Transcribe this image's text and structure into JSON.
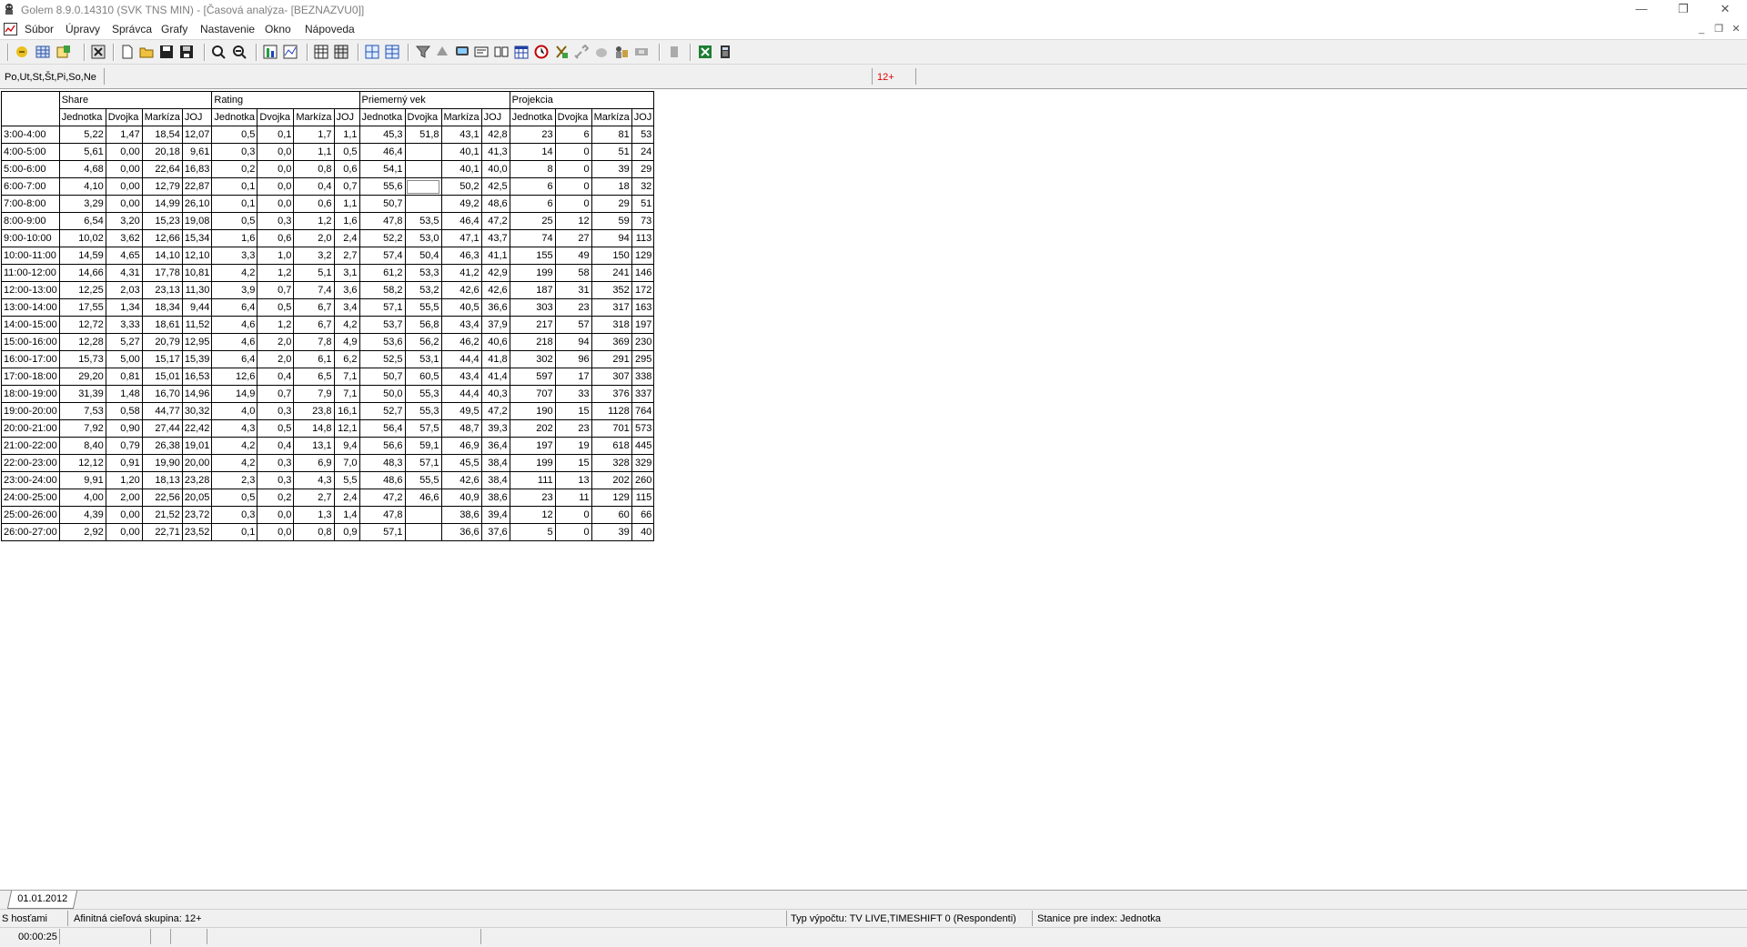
{
  "window": {
    "title": "Golem 8.9.0.14310 (SVK TNS MIN) - [Časová analýza- [BEZNAZVU0]]",
    "controls": {
      "minimize": "—",
      "restore": "❐",
      "close": "✕"
    }
  },
  "menu": [
    "Súbor",
    "Úpravy",
    "Správca",
    "Grafy",
    "Nastavenie",
    "Okno",
    "Nápoveda"
  ],
  "filter": {
    "days": "Po,Ut,St,Št,Pi,So,Ne",
    "target": "12+"
  },
  "table": {
    "groups": [
      "Share",
      "Rating",
      "Priemerný vek",
      "Projekcia"
    ],
    "columns": [
      "Jednotka",
      "Dvojka",
      "Markíza",
      "JOJ"
    ],
    "rows": [
      {
        "label": "3:00-4:00",
        "v": [
          "5,22",
          "1,47",
          "18,54",
          "12,07",
          "0,5",
          "0,1",
          "1,7",
          "1,1",
          "45,3",
          "51,8",
          "43,1",
          "42,8",
          "23",
          "6",
          "81",
          "53"
        ]
      },
      {
        "label": "4:00-5:00",
        "v": [
          "5,61",
          "0,00",
          "20,18",
          "9,61",
          "0,3",
          "0,0",
          "1,1",
          "0,5",
          "46,4",
          "",
          "40,1",
          "41,3",
          "14",
          "0",
          "51",
          "24"
        ]
      },
      {
        "label": "5:00-6:00",
        "v": [
          "4,68",
          "0,00",
          "22,64",
          "16,83",
          "0,2",
          "0,0",
          "0,8",
          "0,6",
          "54,1",
          "",
          "40,1",
          "40,0",
          "8",
          "0",
          "39",
          "29"
        ]
      },
      {
        "label": "6:00-7:00",
        "v": [
          "4,10",
          "0,00",
          "12,79",
          "22,87",
          "0,1",
          "0,0",
          "0,4",
          "0,7",
          "55,6",
          "",
          "50,2",
          "42,5",
          "6",
          "0",
          "18",
          "32"
        ]
      },
      {
        "label": "7:00-8:00",
        "v": [
          "3,29",
          "0,00",
          "14,99",
          "26,10",
          "0,1",
          "0,0",
          "0,6",
          "1,1",
          "50,7",
          "",
          "49,2",
          "48,6",
          "6",
          "0",
          "29",
          "51"
        ]
      },
      {
        "label": "8:00-9:00",
        "v": [
          "6,54",
          "3,20",
          "15,23",
          "19,08",
          "0,5",
          "0,3",
          "1,2",
          "1,6",
          "47,8",
          "53,5",
          "46,4",
          "47,2",
          "25",
          "12",
          "59",
          "73"
        ]
      },
      {
        "label": "9:00-10:00",
        "v": [
          "10,02",
          "3,62",
          "12,66",
          "15,34",
          "1,6",
          "0,6",
          "2,0",
          "2,4",
          "52,2",
          "53,0",
          "47,1",
          "43,7",
          "74",
          "27",
          "94",
          "113"
        ]
      },
      {
        "label": "10:00-11:00",
        "v": [
          "14,59",
          "4,65",
          "14,10",
          "12,10",
          "3,3",
          "1,0",
          "3,2",
          "2,7",
          "57,4",
          "50,4",
          "46,3",
          "41,1",
          "155",
          "49",
          "150",
          "129"
        ]
      },
      {
        "label": "11:00-12:00",
        "v": [
          "14,66",
          "4,31",
          "17,78",
          "10,81",
          "4,2",
          "1,2",
          "5,1",
          "3,1",
          "61,2",
          "53,3",
          "41,2",
          "42,9",
          "199",
          "58",
          "241",
          "146"
        ]
      },
      {
        "label": "12:00-13:00",
        "v": [
          "12,25",
          "2,03",
          "23,13",
          "11,30",
          "3,9",
          "0,7",
          "7,4",
          "3,6",
          "58,2",
          "53,2",
          "42,6",
          "42,6",
          "187",
          "31",
          "352",
          "172"
        ]
      },
      {
        "label": "13:00-14:00",
        "v": [
          "17,55",
          "1,34",
          "18,34",
          "9,44",
          "6,4",
          "0,5",
          "6,7",
          "3,4",
          "57,1",
          "55,5",
          "40,5",
          "36,6",
          "303",
          "23",
          "317",
          "163"
        ]
      },
      {
        "label": "14:00-15:00",
        "v": [
          "12,72",
          "3,33",
          "18,61",
          "11,52",
          "4,6",
          "1,2",
          "6,7",
          "4,2",
          "53,7",
          "56,8",
          "43,4",
          "37,9",
          "217",
          "57",
          "318",
          "197"
        ]
      },
      {
        "label": "15:00-16:00",
        "v": [
          "12,28",
          "5,27",
          "20,79",
          "12,95",
          "4,6",
          "2,0",
          "7,8",
          "4,9",
          "53,6",
          "56,2",
          "46,2",
          "40,6",
          "218",
          "94",
          "369",
          "230"
        ]
      },
      {
        "label": "16:00-17:00",
        "v": [
          "15,73",
          "5,00",
          "15,17",
          "15,39",
          "6,4",
          "2,0",
          "6,1",
          "6,2",
          "52,5",
          "53,1",
          "44,4",
          "41,8",
          "302",
          "96",
          "291",
          "295"
        ]
      },
      {
        "label": "17:00-18:00",
        "v": [
          "29,20",
          "0,81",
          "15,01",
          "16,53",
          "12,6",
          "0,4",
          "6,5",
          "7,1",
          "50,7",
          "60,5",
          "43,4",
          "41,4",
          "597",
          "17",
          "307",
          "338"
        ]
      },
      {
        "label": "18:00-19:00",
        "v": [
          "31,39",
          "1,48",
          "16,70",
          "14,96",
          "14,9",
          "0,7",
          "7,9",
          "7,1",
          "50,0",
          "55,3",
          "44,4",
          "40,3",
          "707",
          "33",
          "376",
          "337"
        ]
      },
      {
        "label": "19:00-20:00",
        "v": [
          "7,53",
          "0,58",
          "44,77",
          "30,32",
          "4,0",
          "0,3",
          "23,8",
          "16,1",
          "52,7",
          "55,3",
          "49,5",
          "47,2",
          "190",
          "15",
          "1128",
          "764"
        ]
      },
      {
        "label": "20:00-21:00",
        "v": [
          "7,92",
          "0,90",
          "27,44",
          "22,42",
          "4,3",
          "0,5",
          "14,8",
          "12,1",
          "56,4",
          "57,5",
          "48,7",
          "39,3",
          "202",
          "23",
          "701",
          "573"
        ]
      },
      {
        "label": "21:00-22:00",
        "v": [
          "8,40",
          "0,79",
          "26,38",
          "19,01",
          "4,2",
          "0,4",
          "13,1",
          "9,4",
          "56,6",
          "59,1",
          "46,9",
          "36,4",
          "197",
          "19",
          "618",
          "445"
        ]
      },
      {
        "label": "22:00-23:00",
        "v": [
          "12,12",
          "0,91",
          "19,90",
          "20,00",
          "4,2",
          "0,3",
          "6,9",
          "7,0",
          "48,3",
          "57,1",
          "45,5",
          "38,4",
          "199",
          "15",
          "328",
          "329"
        ]
      },
      {
        "label": "23:00-24:00",
        "v": [
          "9,91",
          "1,20",
          "18,13",
          "23,28",
          "2,3",
          "0,3",
          "4,3",
          "5,5",
          "48,6",
          "55,5",
          "42,6",
          "38,4",
          "111",
          "13",
          "202",
          "260"
        ]
      },
      {
        "label": "24:00-25:00",
        "v": [
          "4,00",
          "2,00",
          "22,56",
          "20,05",
          "0,5",
          "0,2",
          "2,7",
          "2,4",
          "47,2",
          "46,6",
          "40,9",
          "38,6",
          "23",
          "11",
          "129",
          "115"
        ]
      },
      {
        "label": "25:00-26:00",
        "v": [
          "4,39",
          "0,00",
          "21,52",
          "23,72",
          "0,3",
          "0,0",
          "1,3",
          "1,4",
          "47,8",
          "",
          "38,6",
          "39,4",
          "12",
          "0",
          "60",
          "66"
        ]
      },
      {
        "label": "26:00-27:00",
        "v": [
          "2,92",
          "0,00",
          "22,71",
          "23,52",
          "0,1",
          "0,0",
          "0,8",
          "0,9",
          "57,1",
          "",
          "36,6",
          "37,6",
          "5",
          "0",
          "39",
          "40"
        ]
      }
    ]
  },
  "sheet_tab": "01.01.2012",
  "status": {
    "mode": "S hosťami",
    "affinity": "Afinitná cieľová skupina: 12+",
    "calc_type": "Typ výpočtu: TV LIVE,TIMESHIFT 0 (Respondenti)",
    "index_station": "Stanice pre index: Jednotka",
    "elapsed": "00:00:25"
  }
}
